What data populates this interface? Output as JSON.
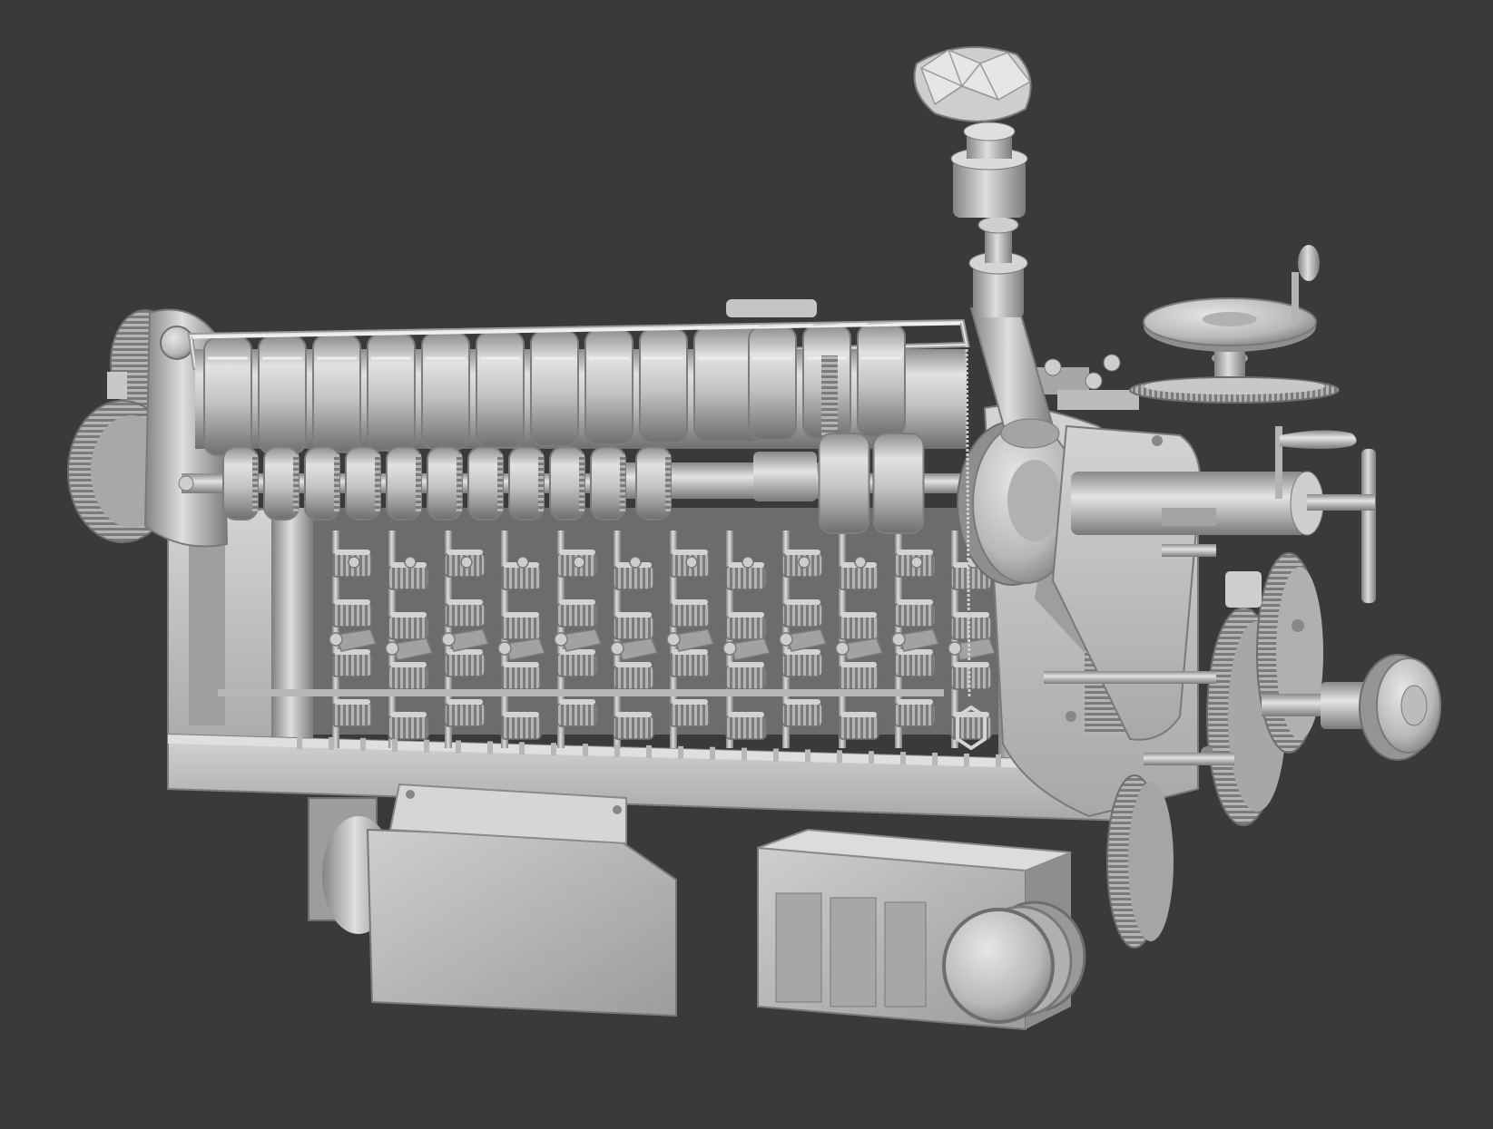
{
  "scene": {
    "subject": "",
    "colors": {
      "background": "#3a3a3a",
      "body": "#bdbcbc",
      "body_light": "#dcdcdc",
      "body_dark": "#8f8e8e",
      "shadow": "#6f6e6e",
      "deep": "#4e4d4d"
    }
  }
}
